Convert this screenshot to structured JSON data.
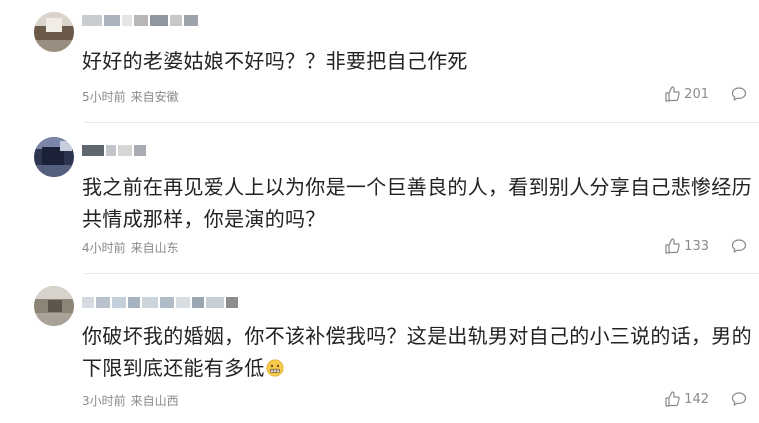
{
  "comments": [
    {
      "text": "好好的老婆姑娘不好吗？？非要把自己作死",
      "time": "5小时前",
      "location": "来自安徽",
      "likes": "201"
    },
    {
      "text": "我之前在再见爱人上以为你是一个巨善良的人，看到别人分享自己悲惨经历共情成那样，你是演的吗？",
      "time": "4小时前",
      "location": "来自山东",
      "likes": "133"
    },
    {
      "text": "你破坏我的婚姻，你不该补偿我吗？这是出轨男对自己的小三说的话，男的下限到底还能有多低",
      "time": "3小时前",
      "location": "来自山西",
      "likes": "142"
    }
  ],
  "icons": {
    "like": "thumbs-up-icon",
    "comment": "speech-bubble-icon",
    "emoji": "grimacing-face-emoji"
  },
  "colors": {
    "text": "#222222",
    "meta": "#8a8a8a",
    "divider": "#e6e6e6"
  }
}
